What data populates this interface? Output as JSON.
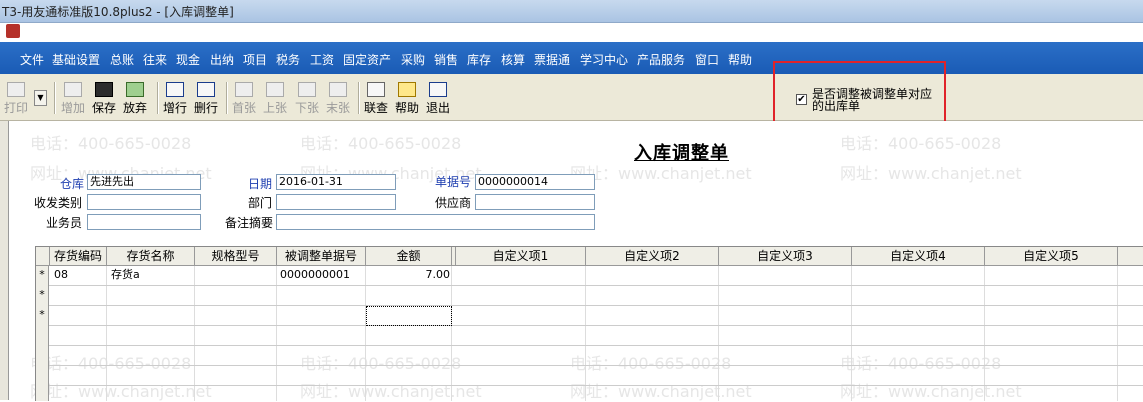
{
  "window": {
    "title": "T3-用友通标准版10.8plus2 - [入库调整单]"
  },
  "menu": [
    "文件",
    "基础设置",
    "总账",
    "往来",
    "现金",
    "出纳",
    "项目",
    "税务",
    "工资",
    "固定资产",
    "采购",
    "销售",
    "库存",
    "核算",
    "票据通",
    "学习中心",
    "产品服务",
    "窗口",
    "帮助"
  ],
  "toolbar": {
    "buttons": [
      {
        "label": "打印",
        "disabled": true
      },
      {
        "label": "增加",
        "disabled": true
      },
      {
        "label": "保存",
        "disabled": false
      },
      {
        "label": "放弃",
        "disabled": false
      },
      {
        "label": "增行",
        "disabled": false
      },
      {
        "label": "删行",
        "disabled": false
      },
      {
        "label": "首张",
        "disabled": true
      },
      {
        "label": "上张",
        "disabled": true
      },
      {
        "label": "下张",
        "disabled": true
      },
      {
        "label": "末张",
        "disabled": true
      },
      {
        "label": "联查",
        "disabled": false
      },
      {
        "label": "帮助",
        "disabled": false
      },
      {
        "label": "退出",
        "disabled": false
      }
    ],
    "checkbox": {
      "label": "是否调整被调整单对应的出库单",
      "checked": true,
      "mark": "✔"
    }
  },
  "form": {
    "title": "入库调整单",
    "warehouse_label": "仓库",
    "warehouse_value": "先进先出",
    "date_label": "日期",
    "date_value": "2016-01-31",
    "docno_label": "单据号",
    "docno_value": "0000000014",
    "rectype_label": "收发类别",
    "rectype_value": "",
    "dept_label": "部门",
    "dept_value": "",
    "supplier_label": "供应商",
    "supplier_value": "",
    "clerk_label": "业务员",
    "clerk_value": "",
    "remark_label": "备注摘要",
    "remark_value": ""
  },
  "grid": {
    "headers": [
      "存货编码",
      "存货名称",
      "规格型号",
      "被调整单据号",
      "金额",
      "",
      "自定义项1",
      "自定义项2",
      "自定义项3",
      "自定义项4",
      "自定义项5"
    ],
    "rows": [
      {
        "marker": "*",
        "code": "08",
        "name": "存货a",
        "spec": "",
        "ref": "0000000001",
        "amount": "7.00"
      },
      {
        "marker": "*",
        "code": "",
        "name": "",
        "spec": "",
        "ref": "",
        "amount": ""
      },
      {
        "marker": "*",
        "code": "",
        "name": "",
        "spec": "",
        "ref": "",
        "amount": ""
      }
    ]
  },
  "watermark": {
    "phone": "电话：400-665-0028",
    "site": "网址：www.chanjet.net"
  }
}
